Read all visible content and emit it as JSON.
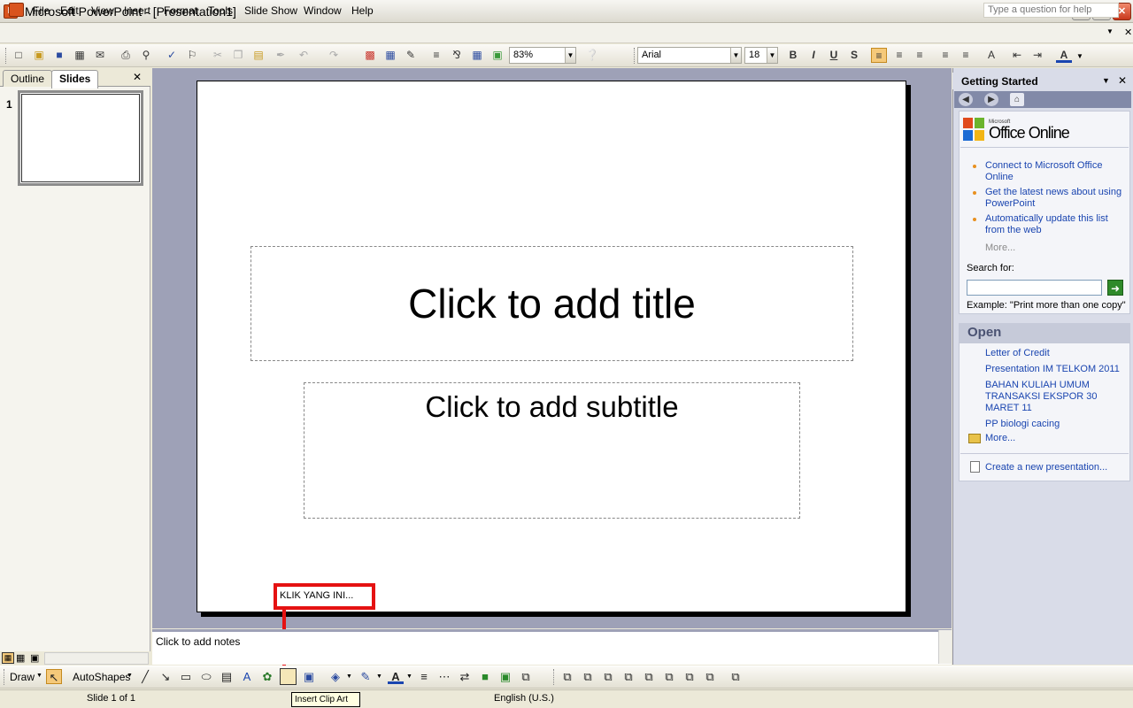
{
  "window": {
    "title": "Microsoft PowerPoint - [Presentation1]"
  },
  "menu": {
    "items": [
      "File",
      "Edit",
      "View",
      "Insert",
      "Format",
      "Tools",
      "Slide Show",
      "Window",
      "Help"
    ],
    "help_placeholder": "Type a question for help"
  },
  "toolbar": {
    "zoom": "83%",
    "font": "Arial",
    "size": "18"
  },
  "left_pane": {
    "tab_outline": "Outline",
    "tab_slides": "Slides",
    "slide_number": "1"
  },
  "slide": {
    "title_placeholder": "Click to add title",
    "subtitle_placeholder": "Click to add subtitle"
  },
  "annotation": {
    "callout": "KLIK YANG INI..."
  },
  "notes": {
    "placeholder": "Click to add notes"
  },
  "task_pane": {
    "title": "Getting Started",
    "office_online": "Office Online",
    "office_online_small": "Microsoft",
    "links": [
      "Connect to Microsoft Office Online",
      "Get the latest news about using PowerPoint",
      "Automatically update this list from the web"
    ],
    "more": "More...",
    "search_label": "Search for:",
    "example": "Example:  \"Print more than one copy\"",
    "open_header": "Open",
    "open_files": [
      "Letter of Credit",
      "Presentation IM TELKOM 2011",
      "BAHAN KULIAH UMUM TRANSAKSI EKSPOR 30 MARET 11",
      "PP biologi cacing"
    ],
    "open_more": "More...",
    "create_new": "Create a new presentation..."
  },
  "drawing_toolbar": {
    "draw": "Draw",
    "autoshapes": "AutoShapes"
  },
  "tooltip": {
    "text": "Insert Clip Art"
  },
  "status": {
    "slide": "Slide 1 of 1",
    "language": "English (U.S.)"
  }
}
